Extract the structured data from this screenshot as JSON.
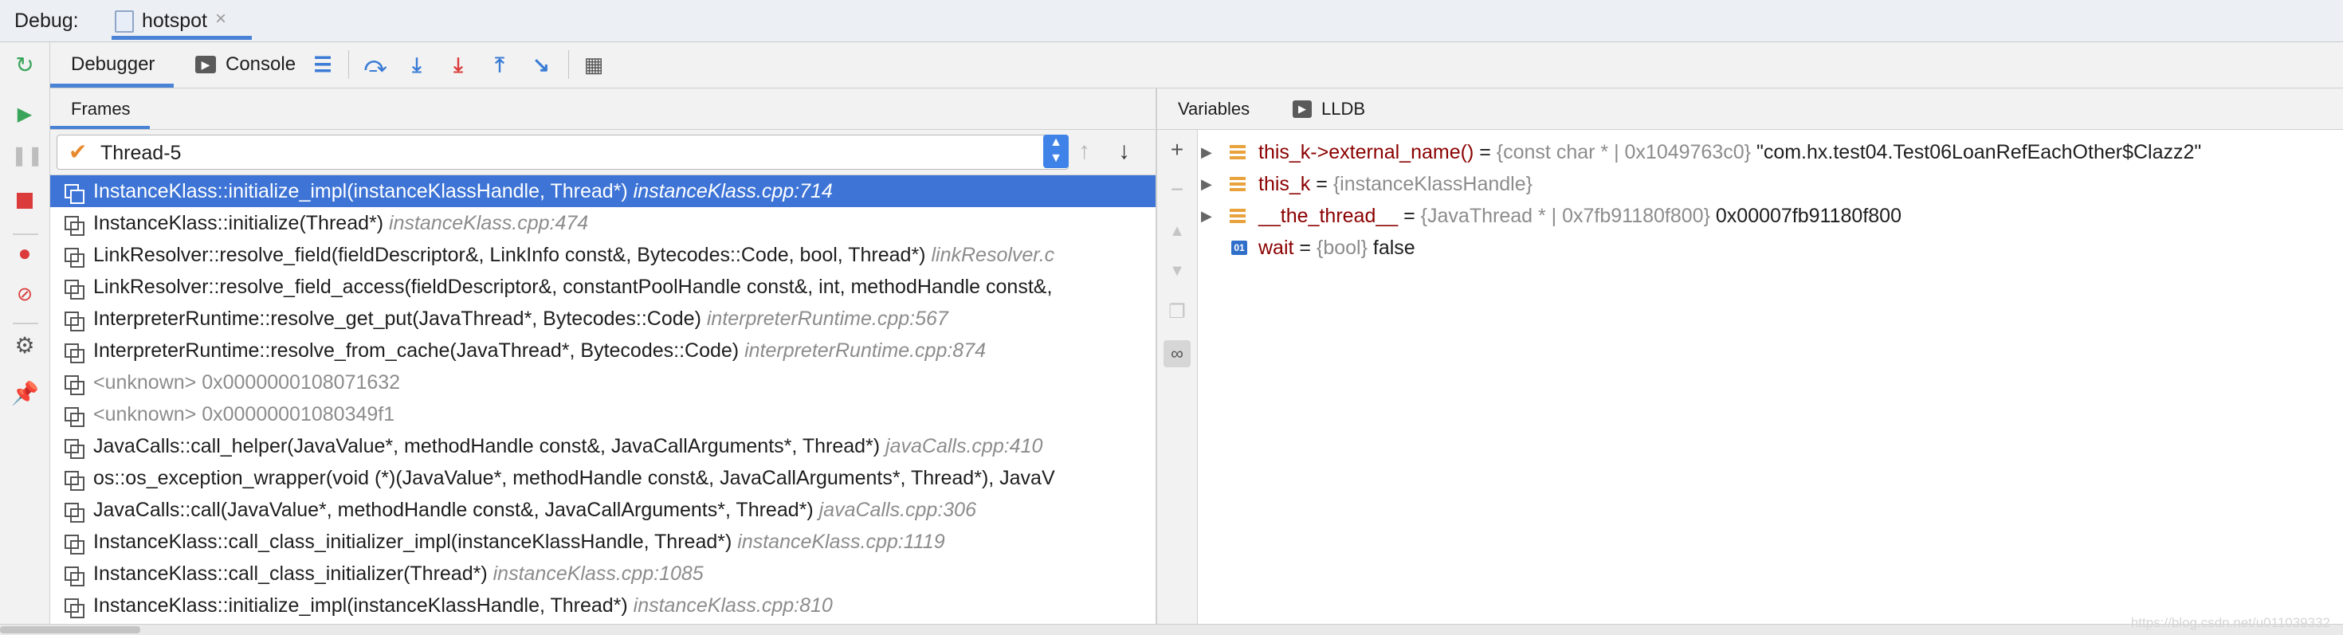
{
  "topbar": {
    "debug_label": "Debug:",
    "session_tab": "hotspot",
    "close_glyph": "×"
  },
  "toolbar": {
    "tabs": [
      {
        "label": "Debugger"
      },
      {
        "label": "Console"
      }
    ],
    "console_icon": "terminal-icon",
    "buttons": [
      "show-execution-point-icon",
      "step-over-icon",
      "step-into-icon",
      "force-step-into-icon",
      "step-out-icon",
      "run-to-cursor-icon",
      "evaluate-expression-icon"
    ]
  },
  "left_strip": [
    "rerun-icon",
    "resume-icon",
    "pause-icon",
    "stop-icon",
    "view-breakpoints-icon",
    "mute-breakpoints-icon",
    "settings-icon",
    "pin-icon"
  ],
  "frames": {
    "title": "Frames",
    "thread": "Thread-5",
    "items": [
      {
        "sig": "InstanceKlass::initialize_impl(instanceKlassHandle, Thread*)",
        "loc": "instanceKlass.cpp:714",
        "selected": true
      },
      {
        "sig": "InstanceKlass::initialize(Thread*)",
        "loc": "instanceKlass.cpp:474"
      },
      {
        "sig": "LinkResolver::resolve_field(fieldDescriptor&, LinkInfo const&, Bytecodes::Code, bool, Thread*)",
        "loc": "linkResolver.c"
      },
      {
        "sig": "LinkResolver::resolve_field_access(fieldDescriptor&, constantPoolHandle const&, int, methodHandle const&,",
        "loc": ""
      },
      {
        "sig": "InterpreterRuntime::resolve_get_put(JavaThread*, Bytecodes::Code)",
        "loc": "interpreterRuntime.cpp:567"
      },
      {
        "sig": "InterpreterRuntime::resolve_from_cache(JavaThread*, Bytecodes::Code)",
        "loc": "interpreterRuntime.cpp:874"
      },
      {
        "sig": "<unknown> 0x0000000108071632",
        "loc": "",
        "unknown": true
      },
      {
        "sig": "<unknown> 0x00000001080349f1",
        "loc": "",
        "unknown": true
      },
      {
        "sig": "JavaCalls::call_helper(JavaValue*, methodHandle const&, JavaCallArguments*, Thread*)",
        "loc": "javaCalls.cpp:410"
      },
      {
        "sig": "os::os_exception_wrapper(void (*)(JavaValue*, methodHandle const&, JavaCallArguments*, Thread*), JavaV",
        "loc": ""
      },
      {
        "sig": "JavaCalls::call(JavaValue*, methodHandle const&, JavaCallArguments*, Thread*)",
        "loc": "javaCalls.cpp:306"
      },
      {
        "sig": "InstanceKlass::call_class_initializer_impl(instanceKlassHandle, Thread*)",
        "loc": "instanceKlass.cpp:1119"
      },
      {
        "sig": "InstanceKlass::call_class_initializer(Thread*)",
        "loc": "instanceKlass.cpp:1085"
      },
      {
        "sig": "InstanceKlass::initialize_impl(instanceKlassHandle, Thread*)",
        "loc": "instanceKlass.cpp:810"
      }
    ]
  },
  "variables": {
    "tabs": [
      {
        "label": "Variables"
      },
      {
        "label": "LLDB"
      }
    ],
    "items": [
      {
        "name": "this_k->external_name()",
        "eq": " = ",
        "type": "{const char * | 0x1049763c0}",
        "value": " \"com.hx.test04.Test06LoanRefEachOther$Clazz2\"",
        "icon": "struct"
      },
      {
        "name": "this_k",
        "eq": " = ",
        "type": "{instanceKlassHandle}",
        "value": "",
        "icon": "struct"
      },
      {
        "name": "__the_thread__",
        "eq": " = ",
        "type": "{JavaThread * | 0x7fb91180f800}",
        "value": " 0x00007fb91180f800",
        "icon": "struct"
      },
      {
        "name": "wait",
        "eq": " = ",
        "type": "{bool}",
        "value": " false",
        "icon": "primitive",
        "badge": "01"
      }
    ],
    "side_buttons": [
      "add-watch-icon",
      "remove-watch-icon",
      "move-up-icon",
      "move-down-icon",
      "duplicate-icon",
      "show-watches-icon"
    ]
  },
  "watermark": "https://blog.csdn.net/u011039332",
  "colors": {
    "accent": "#4a83d6",
    "selection": "#3d74d6",
    "var_name": "#8b0000",
    "location": "#8c8c8c",
    "struct_icon": "#e8a33d"
  }
}
